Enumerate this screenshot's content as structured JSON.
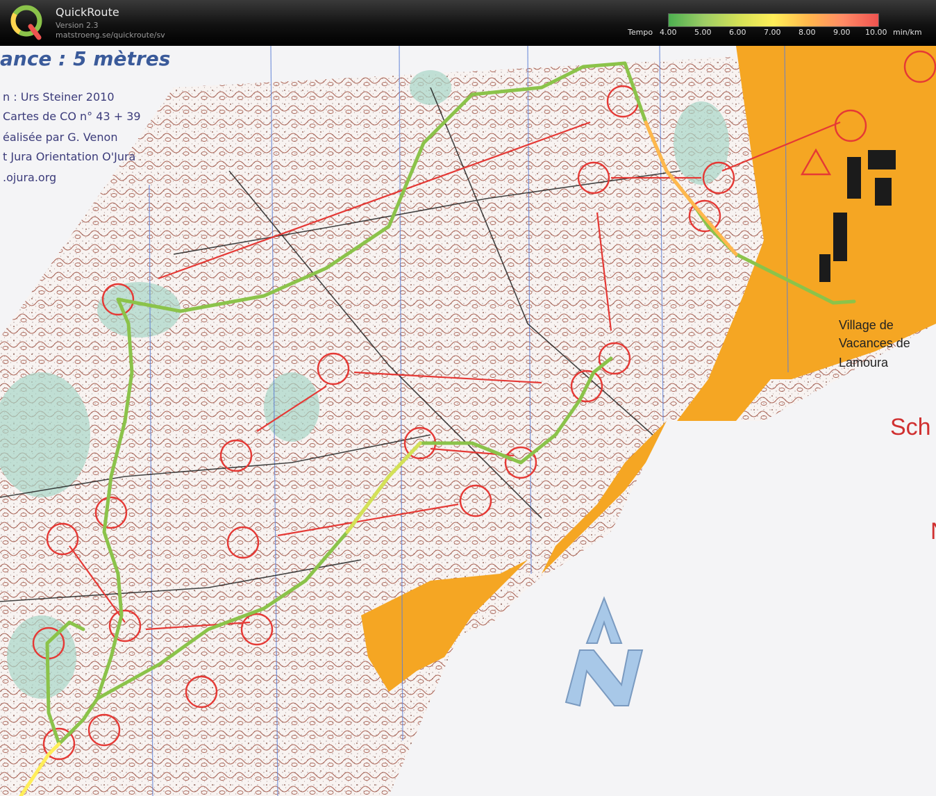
{
  "app": {
    "title": "QuickRoute",
    "version": "Version 2.3",
    "url": "matstroeng.se/quickroute/sv"
  },
  "legend": {
    "label": "Tempo",
    "unit": "min/km",
    "ticks": [
      "4.00",
      "5.00",
      "6.00",
      "7.00",
      "8.00",
      "9.00",
      "10.00"
    ],
    "colors": [
      "#4caf50",
      "#9ccc65",
      "#d4e157",
      "#ffee58",
      "#ffb74d",
      "#ff8a65",
      "#ef5350"
    ]
  },
  "map": {
    "scale_text": "ance  : 5 mètres",
    "credits": [
      "n :  Urs Steiner 2010",
      "Cartes de CO n° 43 + 39",
      "éalisée par G. Venon",
      "t Jura Orientation O'Jura",
      ".ojura.org"
    ],
    "place_label": [
      "Village de",
      "Vacances de",
      "Lamoura"
    ],
    "handwritten": [
      "Sch",
      "N"
    ],
    "colors": {
      "paper": "#f7f7f7",
      "forest_white": "#faf8f7",
      "open_land": "#f5a623",
      "contour": "#8b3a2a",
      "course_line": "#e53935",
      "route": "#8bc34a",
      "green_vegetation": "#a8d5c8",
      "north_arrow": "#a8c8e8"
    }
  }
}
